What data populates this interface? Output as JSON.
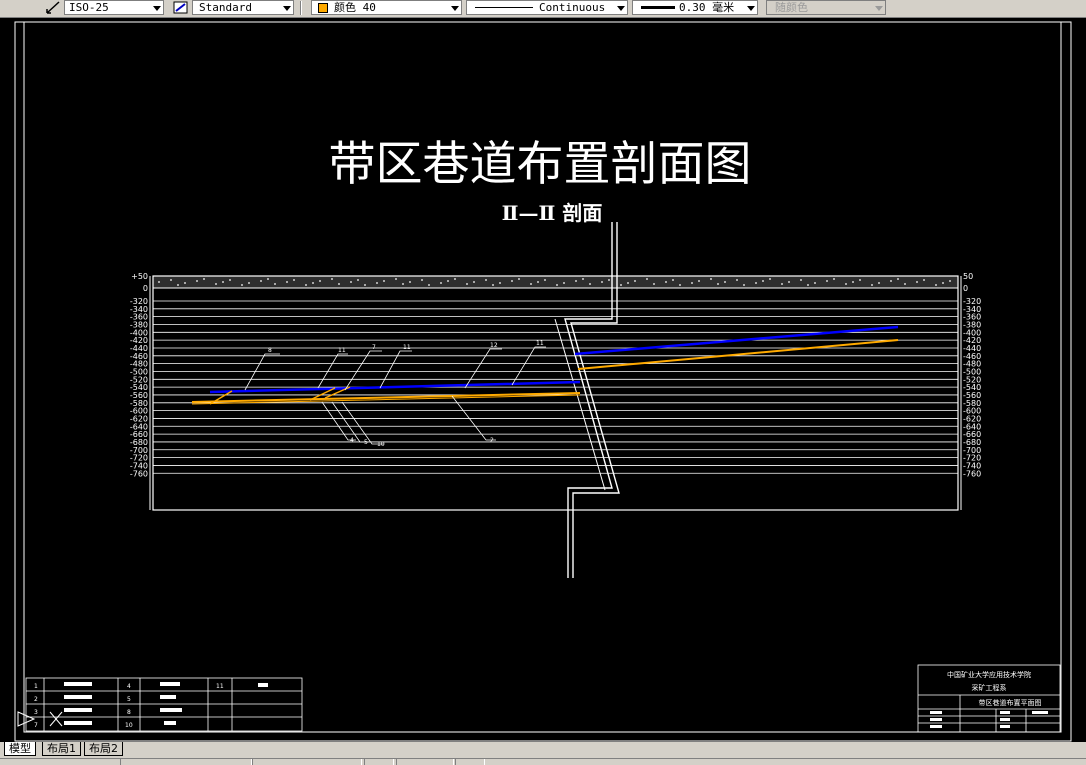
{
  "toolbar": {
    "dimstyle": "ISO-25",
    "tablestyle": "Standard",
    "color": "颜色 40",
    "color_swatch": "#ffaa00",
    "linetype": "Continuous",
    "lineweight": "0.30 毫米",
    "plotstyle": "随颜色"
  },
  "drawing": {
    "title": "带区巷道布置剖面图",
    "subtitle": "Ⅱ—Ⅱ 剖面",
    "scale_left": [
      "+50",
      "0",
      "-320",
      "-340",
      "-360",
      "-380",
      "-400",
      "-420",
      "-440",
      "-460",
      "-480",
      "-500",
      "-520",
      "-540",
      "-560",
      "-580",
      "-600",
      "-620",
      "-640",
      "-660",
      "-680",
      "-700",
      "-720",
      "-740",
      "-760"
    ],
    "scale_right": [
      "50",
      "0",
      "320",
      "340",
      "360",
      "380",
      "400",
      "420",
      "440",
      "460",
      "480",
      "500",
      "520",
      "540",
      "560",
      "580",
      "600",
      "620",
      "640",
      "660",
      "680",
      "700",
      "720",
      "740",
      "760"
    ],
    "tags_top": [
      "8",
      "11",
      "7",
      "11",
      "12",
      "11"
    ],
    "tags_bottom": [
      "4",
      "5",
      "10",
      "2"
    ],
    "colors": {
      "roadway_blue": "#0000ff",
      "roadway_orange": "#ffaa00",
      "lines": "#ffffff"
    }
  },
  "legend": {
    "numbers": [
      "1",
      "2",
      "3",
      "7",
      "4",
      "5",
      "8",
      "10",
      "11"
    ]
  },
  "title_block": {
    "school": "中国矿业大学应用技术学院",
    "dept": "采矿工程系",
    "name": "带区巷道布置平面图"
  },
  "tabs": [
    "模型",
    "布局1",
    "布局2"
  ]
}
